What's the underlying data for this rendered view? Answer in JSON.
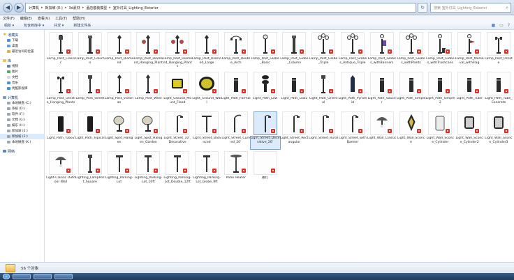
{
  "window": {
    "breadcrumb": [
      "计算机",
      "新加坡 (E:)",
      "3d素材",
      "酒店套装模型",
      "室外灯具_Lighting_Exterior"
    ],
    "search_placeholder": "搜索 室外灯具_Lighting_Exterior"
  },
  "menu": [
    "文件(F)",
    "编辑(E)",
    "查看(V)",
    "工具(T)",
    "帮助(H)"
  ],
  "toolbar": [
    "组织 ▾",
    "包含到库中 ▾",
    "共享 ▾",
    "新建文件夹"
  ],
  "sidebar": {
    "favorites_title": "收藏夹",
    "favorites": [
      "下载",
      "桌面",
      "最近访问的位置"
    ],
    "library_title": "库",
    "libraries": [
      "视频",
      "图片",
      "文档",
      "音乐",
      "优酷影视库"
    ],
    "computer_title": "计算机",
    "drives": [
      "本地磁盘 (C:)",
      "系统 (D:)",
      "软件 (F:)",
      "文档 (G:)",
      "娱乐 (H:)",
      "新加坡 (E:)",
      "新加坡 (E:)",
      "本地磁盘 (K:)"
    ],
    "network_title": "网络"
  },
  "files": [
    {
      "name": "Lamp_Post_Classic",
      "kind": "classic"
    },
    {
      "name": "Lamp_Post_Column",
      "kind": "column"
    },
    {
      "name": "Lamp_Post_Diamond",
      "kind": "pole"
    },
    {
      "name": "Lamp_Post_Diamond_Hanging_Plant",
      "kind": "hanging"
    },
    {
      "name": "Lamp_Post_Diamond_Hanging_Plants",
      "kind": "hanging2"
    },
    {
      "name": "Lamp_Post_Diamond_Large",
      "kind": "pole"
    },
    {
      "name": "Lamp_Post_Double_Arch",
      "kind": "double"
    },
    {
      "name": "Lamp_Post_Globe_Basic",
      "kind": "globe"
    },
    {
      "name": "Lamp_Post_Globe_Column",
      "kind": "column"
    },
    {
      "name": "Lamp_Post_Globe_Triple",
      "kind": "triple"
    },
    {
      "name": "Lamp_Post_Globes_Antique_Triple",
      "kind": "triple"
    },
    {
      "name": "Lamp_Post_Globes_withBanners",
      "kind": "banner"
    },
    {
      "name": "Lamp_Post_Globes_withPlants",
      "kind": "triple"
    },
    {
      "name": "Lamp_Post_Globes_withTrashcans",
      "kind": "trash"
    },
    {
      "name": "Lamp_Post_Medieval_withFlag",
      "kind": "flag"
    },
    {
      "name": "Lamp_Post_Ornate",
      "kind": "ornate"
    },
    {
      "name": "Lamp_Post_Ornate_Hanging_Plants",
      "kind": "ornate"
    },
    {
      "name": "Lamp_Post_Street",
      "kind": "street"
    },
    {
      "name": "Lamp_Post_Victorian",
      "kind": "pole"
    },
    {
      "name": "Lamp_Post_West",
      "kind": "pole"
    },
    {
      "name": "Light_Ground_Mount_Flood",
      "kind": "flood"
    },
    {
      "name": "Light_Ground_Wall",
      "kind": "groundwall"
    },
    {
      "name": "Light_Path_Formal",
      "kind": "bollard"
    },
    {
      "name": "Light_Path_Low",
      "kind": "lowpath"
    },
    {
      "name": "Light_Path_Low2",
      "kind": "bollard"
    },
    {
      "name": "Light_Path_Oriental",
      "kind": "street"
    },
    {
      "name": "Light_Path_Pyramid",
      "kind": "pyramid"
    },
    {
      "name": "Light_Path_Saucer",
      "kind": "bollard"
    },
    {
      "name": "Light_Path_Simple",
      "kind": "bollard"
    },
    {
      "name": "Light_Path_Simple2",
      "kind": "bollard"
    },
    {
      "name": "Light_Path_Tube",
      "kind": "bollard"
    },
    {
      "name": "Light_Path_Tube_Concrete",
      "kind": "bollard"
    },
    {
      "name": "Light_Path_Tube2",
      "kind": "tube"
    },
    {
      "name": "Light_Path_Typical",
      "kind": "tube"
    },
    {
      "name": "Light_Spot_Halogen",
      "kind": "spot"
    },
    {
      "name": "Light_Spot_Halogen_Garden",
      "kind": "spot"
    },
    {
      "name": "Light_Street_10'_Decorative",
      "kind": "streetlamp"
    },
    {
      "name": "Light_Street_Balanced",
      "kind": "tlamp"
    },
    {
      "name": "Light_Street_Curved_20'",
      "kind": "curved"
    },
    {
      "name": "Light_Street_Decorative_20'",
      "kind": "streetlamp",
      "selected": true
    },
    {
      "name": "Light_Street_Rectangular",
      "kind": "streetlamp"
    },
    {
      "name": "Light_Street_Rural",
      "kind": "streetlamp"
    },
    {
      "name": "Light_Street_withBanner",
      "kind": "streetlamp"
    },
    {
      "name": "Light_Wall_Classic",
      "kind": "wallclassic"
    },
    {
      "name": "Light_Wall_Sconce",
      "kind": "lantern"
    },
    {
      "name": "Light_Wall_Sconce_Cylinder",
      "kind": "cylinder"
    },
    {
      "name": "Light_Wall_Sconce_Cylinder2",
      "kind": "cylinder2"
    },
    {
      "name": "Light_Wall_Sconce_Cylinder3",
      "kind": "cylinder2"
    },
    {
      "name": "Light-Classic Outdoor Wall",
      "kind": "wallclassic"
    },
    {
      "name": "Lighting_LampPost_Square",
      "kind": "street"
    },
    {
      "name": "Lighting_Parking-Lot",
      "kind": "parking"
    },
    {
      "name": "Lighting_Parking-Lot_10ft",
      "kind": "parking"
    },
    {
      "name": "Lighting_Parking-Lot_Double_12ft",
      "kind": "parking"
    },
    {
      "name": "Lighting_Parking-Lot_Globe_9ft",
      "kind": "parking"
    },
    {
      "name": "Patio Heater",
      "kind": "heater"
    },
    {
      "name": "路灯",
      "kind": "blank"
    }
  ],
  "status": {
    "count_text": "56 个对象"
  },
  "taskbar": [
    "",
    "",
    ""
  ],
  "colors": {
    "badge": "#d9302a",
    "selection": "#dcebfc"
  }
}
